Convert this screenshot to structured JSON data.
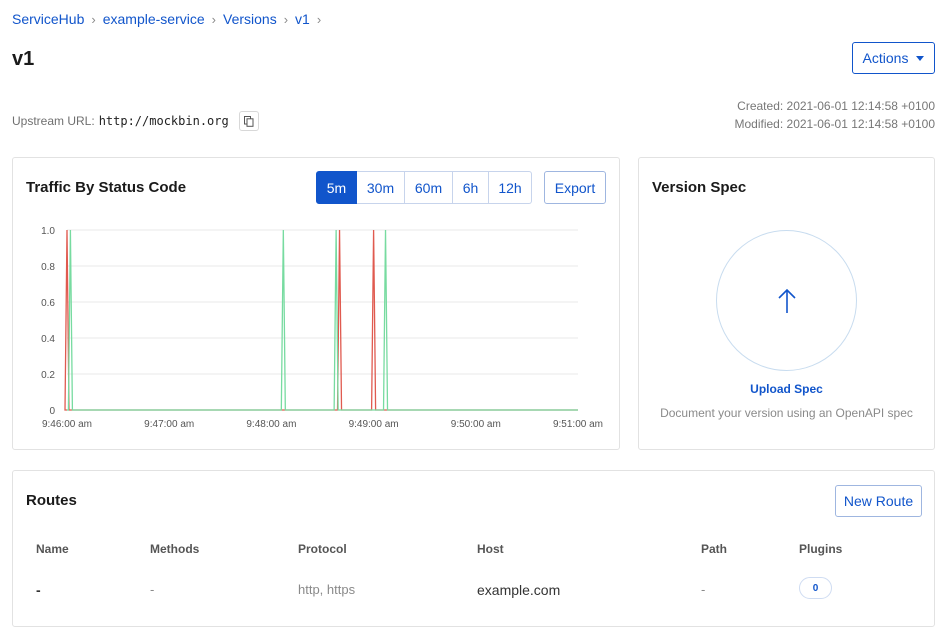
{
  "breadcrumb": [
    "ServiceHub",
    "example-service",
    "Versions",
    "v1"
  ],
  "breadcrumb_separator": "›",
  "page_title": "v1",
  "actions": {
    "label": "Actions"
  },
  "upstream": {
    "label": "Upstream URL:",
    "url": "http://mockbin.org"
  },
  "meta": {
    "created": "Created: 2021-06-01 12:14:58 +0100",
    "modified": "Modified: 2021-06-01 12:14:58 +0100"
  },
  "traffic": {
    "title": "Traffic By Status Code",
    "ranges": [
      "5m",
      "30m",
      "60m",
      "6h",
      "12h"
    ],
    "active_range": "5m",
    "export_label": "Export"
  },
  "chart_data": {
    "type": "line",
    "title": "Traffic By Status Code",
    "xlabel": "",
    "ylabel": "",
    "ylim": [
      0,
      1.0
    ],
    "y_ticks": [
      "0",
      "0.2",
      "0.4",
      "0.6",
      "0.8",
      "1.0"
    ],
    "x_ticks": [
      "9:46:00 am",
      "9:47:00 am",
      "9:48:00 am",
      "9:49:00 am",
      "9:50:00 am",
      "9:51:00 am"
    ],
    "grid": true,
    "series": [
      {
        "color": "#e05a4f",
        "spikes": [
          "9:46:00 am",
          "9:48:40 am",
          "9:49:00 am"
        ],
        "value": 1.0
      },
      {
        "color": "#77dba0",
        "spikes": [
          "9:46:02 am",
          "9:48:07 am",
          "9:48:38 am",
          "9:49:07 am"
        ],
        "value": 1.0
      }
    ]
  },
  "spec": {
    "title": "Version Spec",
    "upload_label": "Upload Spec",
    "description": "Document your version using an OpenAPI spec"
  },
  "routes": {
    "title": "Routes",
    "new_route_label": "New Route",
    "columns": [
      "Name",
      "Methods",
      "Protocol",
      "Host",
      "Path",
      "Plugins"
    ],
    "rows": [
      {
        "name": "-",
        "methods": "-",
        "protocol": "http, https",
        "host": "example.com",
        "path": "-",
        "plugins": "0"
      }
    ]
  },
  "colors": {
    "accent": "#1155cb",
    "error": "#e05a4f",
    "success": "#77dba0"
  },
  "icons": {
    "copy": "copy-icon",
    "caret": "caret-down-icon",
    "upload": "arrow-up-icon"
  }
}
